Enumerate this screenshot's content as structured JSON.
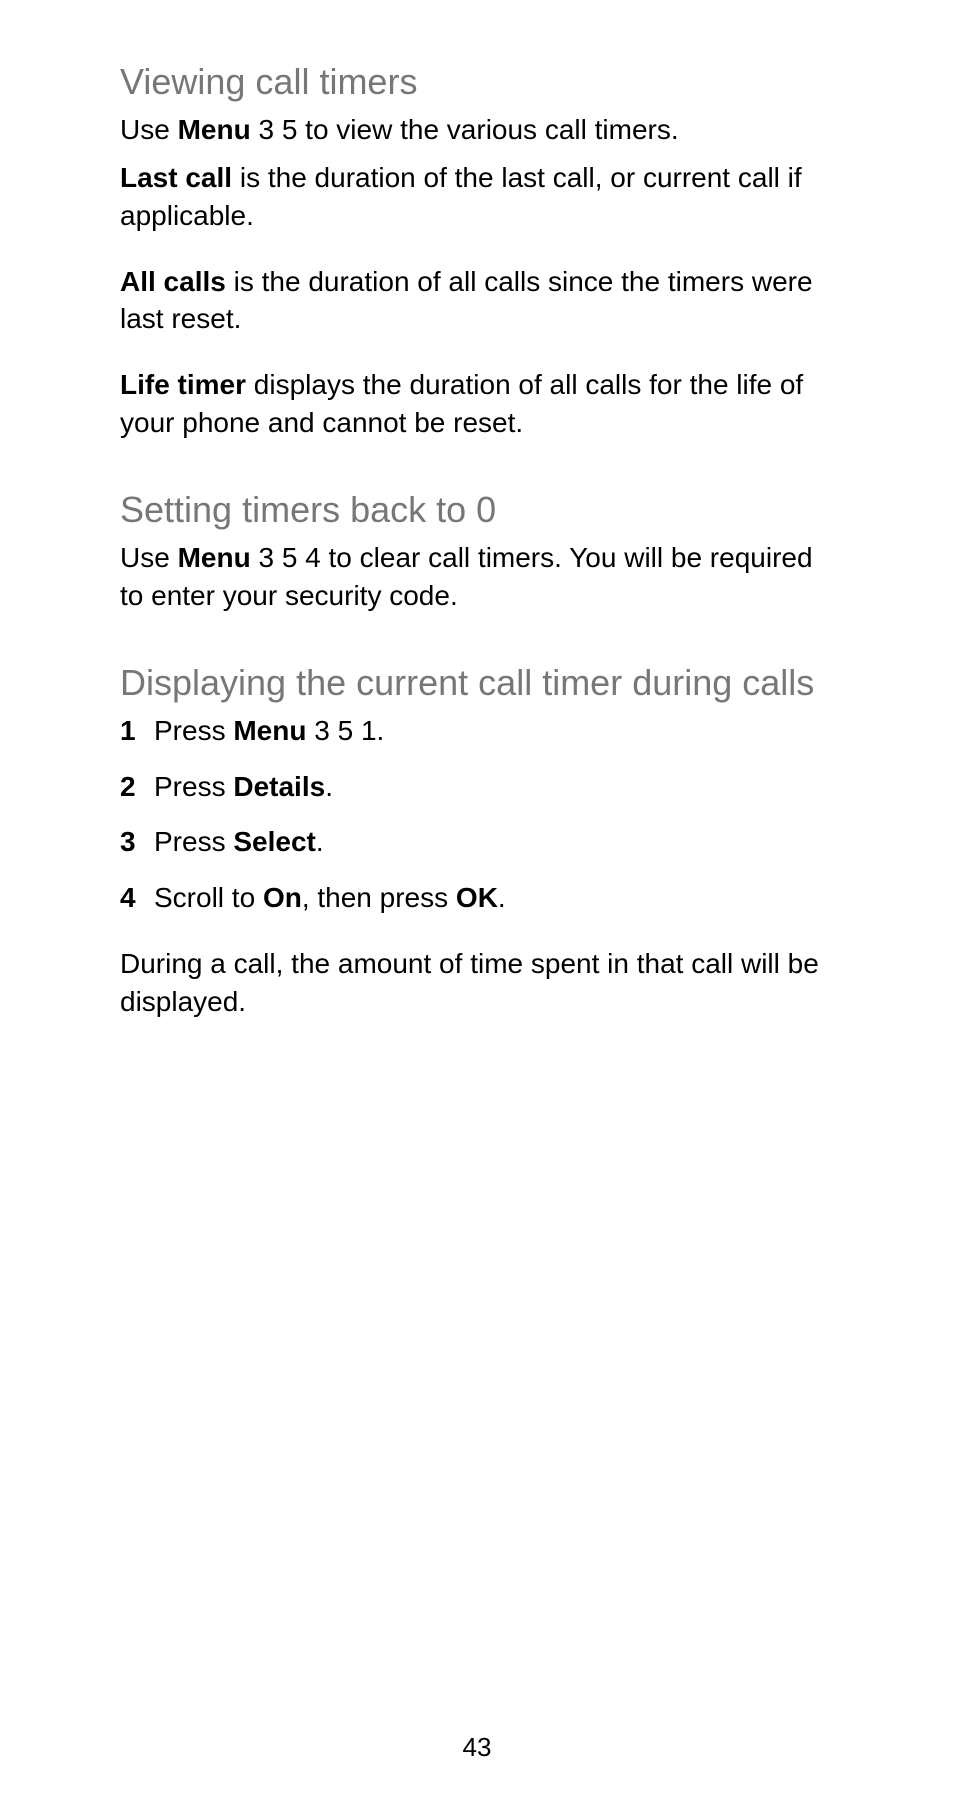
{
  "section1": {
    "heading": "Viewing call timers",
    "p1_a": "Use ",
    "p1_b_bold": "Menu",
    "p1_c": " 3 5 to view the various call timers.",
    "p2_a_bold": "Last call",
    "p2_b": " is the duration of the last call, or current call if applicable.",
    "p3_a_bold": "All calls",
    "p3_b": " is the duration of all calls since the timers were last reset.",
    "p4_a_bold": "Life timer",
    "p4_b": " displays the duration of all calls for the life of your phone and cannot be reset."
  },
  "section2": {
    "heading": "Setting timers back to 0",
    "p1_a": "Use ",
    "p1_b_bold": "Menu",
    "p1_c": " 3 5 4 to clear call timers. You will be required to enter your security code."
  },
  "section3": {
    "heading": "Displaying the current call timer during calls",
    "steps": {
      "n1": "1",
      "s1_a": "Press ",
      "s1_b_bold": "Menu",
      "s1_c": " 3 5 1.",
      "n2": "2",
      "s2_a": "Press ",
      "s2_b_bold": "Details",
      "s2_c": ".",
      "n3": "3",
      "s3_a": "Press ",
      "s3_b_bold": "Select",
      "s3_c": ".",
      "n4": "4",
      "s4_a": "Scroll to ",
      "s4_b_bold": "On",
      "s4_c": ", then press ",
      "s4_d_bold": "OK",
      "s4_e": "."
    },
    "p_after": "During a call, the amount of time spent in that call will be displayed."
  },
  "page_number": "43"
}
